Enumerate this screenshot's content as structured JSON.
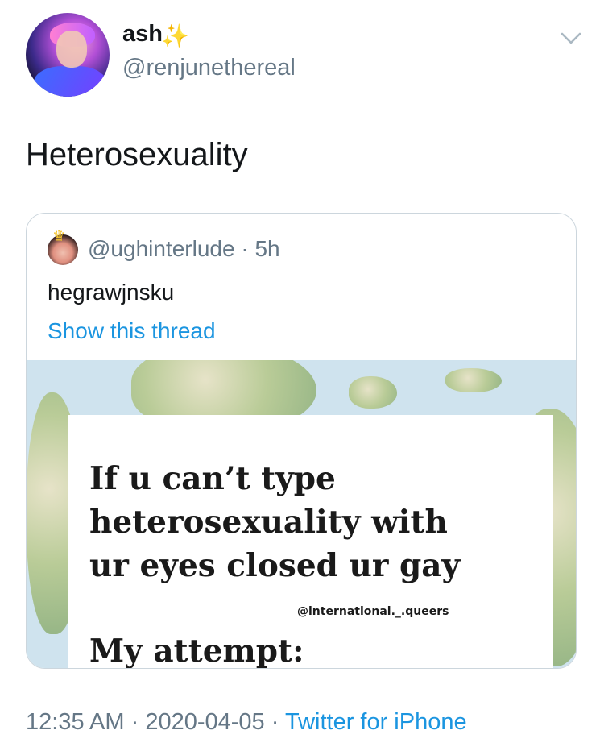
{
  "author": {
    "display_name": "ash",
    "emoji": "✨",
    "handle": "@renjunethereal"
  },
  "tweet": {
    "text": "Heterosexuality"
  },
  "quote": {
    "handle": "@ughinterlude",
    "separator": "·",
    "age": "5h",
    "text": "hegrawjnsku",
    "show_thread": "Show this thread",
    "image": {
      "line1": "If u can’t type",
      "line2": "heterosexuality with",
      "line3": "ur eyes closed ur gay",
      "credit": "@international._.queers",
      "line4": "My attempt:"
    }
  },
  "meta": {
    "time": "12:35 AM",
    "sep1": "·",
    "date": "2020-04-05",
    "sep2": "·",
    "source": "Twitter for iPhone"
  },
  "colors": {
    "link": "#1b95e0",
    "secondary": "#657786",
    "primary": "#14171a"
  },
  "icons": {
    "more": "chevron-down-icon"
  }
}
